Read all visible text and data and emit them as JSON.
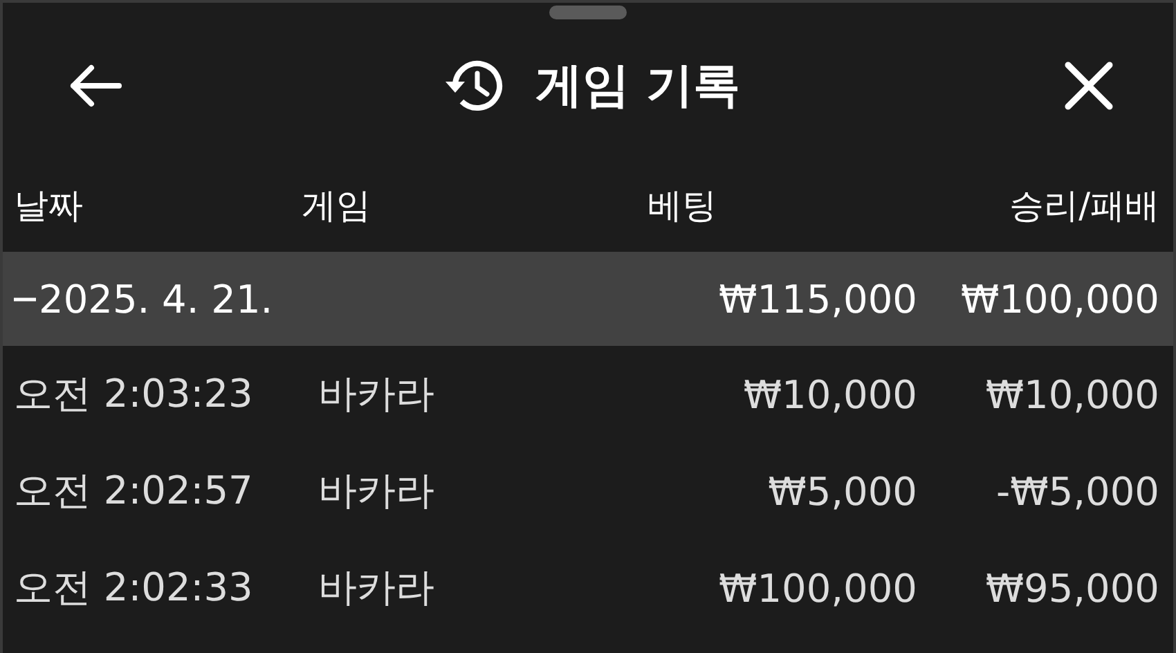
{
  "header": {
    "title": "게임 기록"
  },
  "table": {
    "columns": [
      "날짜",
      "게임",
      "베팅",
      "승리/패배"
    ],
    "groups": [
      {
        "date": "2025. 4. 21.",
        "expanded": true,
        "bet_total": "₩115,000",
        "result_total": "₩100,000",
        "rows": [
          {
            "time": "오전 2:03:23",
            "game": "바카라",
            "bet": "₩10,000",
            "result": "₩10,000"
          },
          {
            "time": "오전 2:02:57",
            "game": "바카라",
            "bet": "₩5,000",
            "result": "-₩5,000"
          },
          {
            "time": "오전 2:02:33",
            "game": "바카라",
            "bet": "₩100,000",
            "result": "₩95,000"
          }
        ]
      }
    ]
  }
}
